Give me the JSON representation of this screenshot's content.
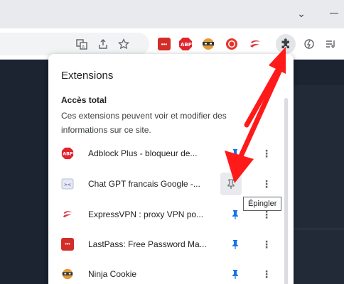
{
  "window": {
    "chevron_glyph": "⌄"
  },
  "toolbar": {
    "extensions": [
      {
        "icon": "lastpass-icon",
        "label": "•••",
        "color": "#d32d27"
      },
      {
        "icon": "adblock-plus-icon",
        "label": "ABP",
        "color": "#e0242e"
      },
      {
        "icon": "ninja-cookie-icon",
        "label": "",
        "color": "#e39b3a"
      },
      {
        "icon": "record-icon",
        "label": "",
        "color": "#e8332a"
      },
      {
        "icon": "expressvpn-icon",
        "label": "",
        "color": "#da3940"
      }
    ]
  },
  "popup": {
    "title": "Extensions",
    "section_title": "Accès total",
    "section_desc": "Ces extensions peuvent voir et modifier des informations sur ce site.",
    "items": [
      {
        "name": "Adblock Plus - bloqueur de...",
        "icon": "adblock-plus-icon",
        "pinned": true
      },
      {
        "name": "Chat GPT francais Google -...",
        "icon": "chat-gpt-icon",
        "pinned": false
      },
      {
        "name": "ExpressVPN : proxy VPN po...",
        "icon": "expressvpn-icon",
        "pinned": true
      },
      {
        "name": "LastPass: Free Password Ma...",
        "icon": "lastpass-icon",
        "pinned": true
      },
      {
        "name": "Ninja Cookie",
        "icon": "ninja-cookie-icon",
        "pinned": true
      }
    ],
    "tooltip": "Épingler"
  },
  "colors": {
    "pin_blue": "#1a73e8",
    "arrow_red": "#ff1a1a",
    "page_dark": "#1c2331"
  }
}
